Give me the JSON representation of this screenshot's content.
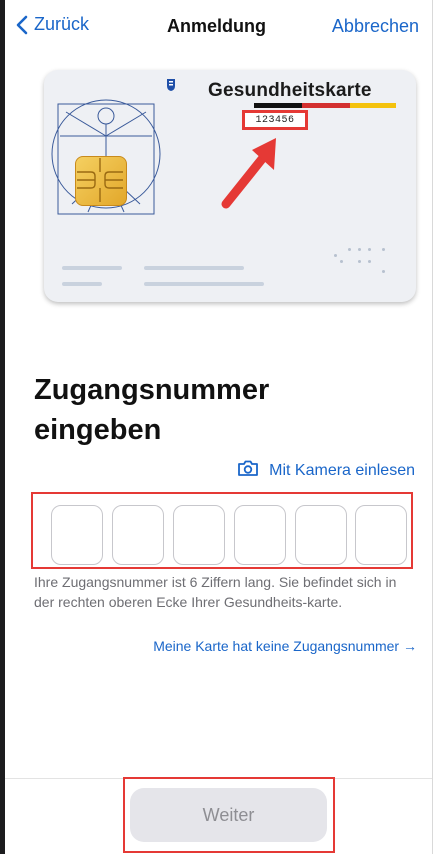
{
  "nav": {
    "back_label": "Zurück",
    "title": "Anmeldung",
    "cancel_label": "Abbrechen"
  },
  "card": {
    "title": "Gesundheitskarte",
    "number": "123456",
    "stripe_colors": [
      "#111111",
      "#d32f2f",
      "#f4c20d"
    ],
    "arrow_color": "#e53935"
  },
  "main": {
    "heading_line1": "Zugangsnummer",
    "heading_line2": "eingeben",
    "camera_label": "Mit Kamera einlesen",
    "digit_count": 6,
    "help_text": "Ihre Zugangsnummer ist 6 Ziffern lang. Sie befindet sich in der rechten oberen Ecke Ihrer Gesundheits-karte.",
    "no_number_link": "Meine Karte hat keine Zugangsnummer →"
  },
  "footer": {
    "continue_label": "Weiter"
  },
  "colors": {
    "accent": "#1a66c9",
    "highlight": "#e53935",
    "disabled_bg": "#e5e5ea",
    "disabled_text": "#8e8e93"
  }
}
